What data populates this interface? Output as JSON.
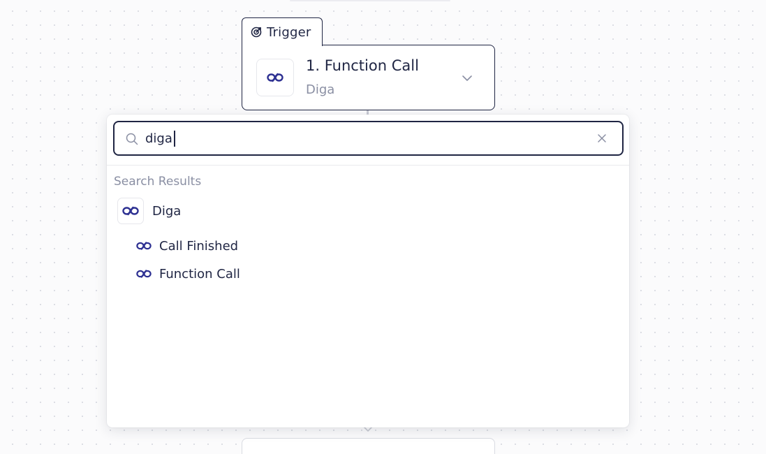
{
  "trigger_tab": {
    "label": "Trigger",
    "icon": "target-icon"
  },
  "step": {
    "title": "1. Function Call",
    "app_name": "Diga",
    "logo": "diga-logo-icon",
    "expand_icon": "chevron-down-icon"
  },
  "search": {
    "value": "diga",
    "placeholder": "",
    "search_icon": "search-icon",
    "clear_icon": "close-icon"
  },
  "results": {
    "heading": "Search Results",
    "app": {
      "name": "Diga",
      "logo": "diga-logo-icon"
    },
    "items": [
      {
        "label": "Call Finished",
        "icon": "diga-logo-icon"
      },
      {
        "label": "Function Call",
        "icon": "diga-logo-icon"
      }
    ]
  },
  "colors": {
    "brand": "#2e3192",
    "text": "#1f2543",
    "muted": "#8a8fa3",
    "border": "#e6e7ec"
  }
}
